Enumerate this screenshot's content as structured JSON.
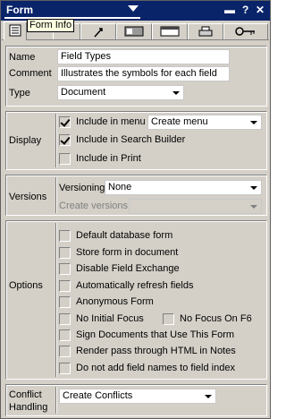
{
  "title": "Form",
  "tooltip": "Form Info",
  "titlebar_icons": [
    "pin-icon",
    "help-icon",
    "close-icon"
  ],
  "titlebar_symbols": {
    "pin": "▬",
    "help": "?",
    "close": "✕"
  },
  "tabs": [
    "info-tab-icon",
    "defaults-tab-icon",
    "launch-tab-icon",
    "background-tab-icon",
    "header-tab-icon",
    "print-tab-icon",
    "security-tab-icon"
  ],
  "basics": {
    "name_label": "Name",
    "name_value": "Field Types",
    "comment_label": "Comment",
    "comment_value": "Illustrates the symbols for each field",
    "type_label": "Type",
    "type_value": "Document"
  },
  "display": {
    "label": "Display",
    "include_menu": {
      "label": "Include in menu",
      "checked": true,
      "value": "Create menu"
    },
    "include_search": {
      "label": "Include in Search Builder",
      "checked": true
    },
    "include_print": {
      "label": "Include in Print",
      "checked": false
    }
  },
  "versions": {
    "label": "Versions",
    "versioning_label": "Versioning",
    "versioning_value": "None",
    "create_label": "Create versions",
    "create_value": ""
  },
  "options": {
    "label": "Options",
    "items": [
      {
        "label": "Default database form",
        "checked": false
      },
      {
        "label": "Store form in document",
        "checked": false
      },
      {
        "label": "Disable Field Exchange",
        "checked": false
      },
      {
        "label": "Automatically refresh fields",
        "checked": false
      },
      {
        "label": "Anonymous Form",
        "checked": false
      },
      {
        "label": "No Initial Focus",
        "checked": false
      },
      {
        "label": "Sign Documents that Use This Form",
        "checked": false
      },
      {
        "label": "Render pass through HTML in Notes",
        "checked": false
      },
      {
        "label": "Do not add field names to field index",
        "checked": false
      }
    ],
    "no_focus_f6": {
      "label": "No Focus On F6",
      "checked": false
    }
  },
  "conflict": {
    "label_line1": "Conflict",
    "label_line2": "Handling",
    "value": "Create Conflicts"
  }
}
